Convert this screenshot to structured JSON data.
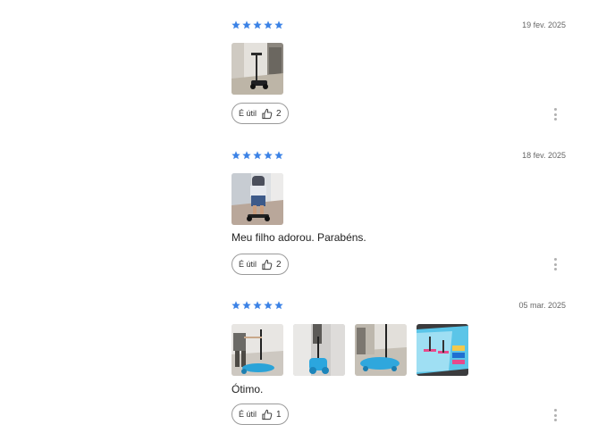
{
  "colors": {
    "star": "#3b82e6",
    "border": "#9a9a9a"
  },
  "icons": {
    "rating": "star-icon",
    "useful": "thumbs-up-icon",
    "menu": "more-vertical-icon"
  },
  "reviews": [
    {
      "rating": 5,
      "date": "19 fev. 2025",
      "text": "",
      "useful_label": "É útil",
      "useful_count": "2",
      "photo_count": 1
    },
    {
      "rating": 5,
      "date": "18 fev. 2025",
      "text": "Meu filho adorou. Parabéns.",
      "useful_label": "É útil",
      "useful_count": "2",
      "photo_count": 1
    },
    {
      "rating": 5,
      "date": "05 mar. 2025",
      "text": "Ótimo.",
      "useful_label": "É útil",
      "useful_count": "1",
      "photo_count": 4
    }
  ]
}
